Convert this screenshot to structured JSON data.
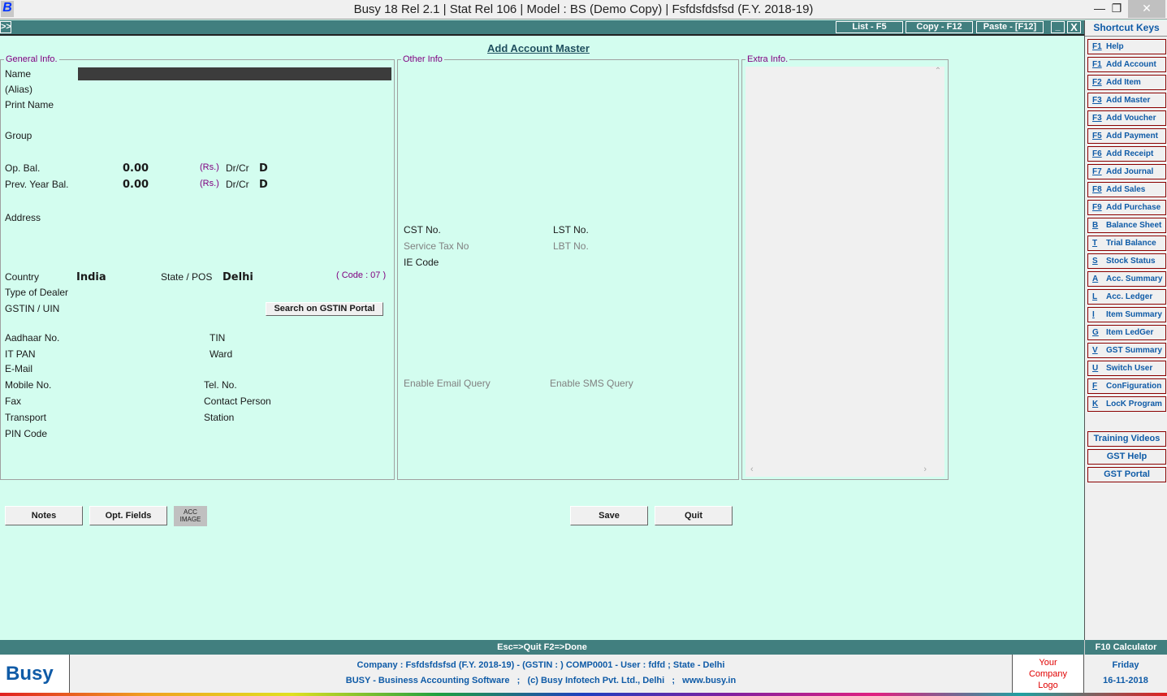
{
  "window": {
    "title": "Busy 18  Rel 2.1  |  Stat Rel 106  |  Model : BS (Demo Copy)  |  Fsfdsfdsfsd (F.Y. 2018-19)",
    "logo": "B",
    "minimize": "—",
    "restore": "❐",
    "close": "✕"
  },
  "toolbar": {
    "expand": ">>",
    "list": "List - F5",
    "copy": "Copy - F12",
    "paste": "Paste - [F12]",
    "min": "_",
    "close": "X"
  },
  "form": {
    "title": "Add Account Master",
    "general": {
      "legend": "General Info.",
      "name": "Name",
      "alias": "(Alias)",
      "print_name": "Print Name",
      "group": "Group",
      "op_bal": "Op. Bal.",
      "op_bal_value": "0.00",
      "prev_bal": "Prev. Year Bal.",
      "prev_bal_value": "0.00",
      "rs": "(Rs.)",
      "drcr": "Dr/Cr",
      "op_drcr_value": "D",
      "prev_drcr_value": "D",
      "address": "Address",
      "country": "Country",
      "country_value": "India",
      "state": "State / POS",
      "state_value": "Delhi",
      "code": "( Code : 07 )",
      "dealer": "Type of Dealer",
      "gstin": "GSTIN / UIN",
      "search_gstin": "Search on GSTIN Portal",
      "aadhaar": "Aadhaar No.",
      "tin": "TIN",
      "itpan": "IT PAN",
      "ward": "Ward",
      "email": "E-Mail",
      "mobile": "Mobile No.",
      "tel": "Tel. No.",
      "fax": "Fax",
      "contact": "Contact Person",
      "transport": "Transport",
      "station": "Station",
      "pin": "PIN Code"
    },
    "other": {
      "legend": "Other Info",
      "cst": "CST No.",
      "lst": "LST No.",
      "service_tax": "Service Tax No",
      "lbt": "LBT No.",
      "ie": "IE Code",
      "email_query": "Enable Email Query",
      "sms_query": "Enable SMS Query"
    },
    "extra": {
      "legend": "Extra Info."
    },
    "buttons": {
      "notes": "Notes",
      "opt_fields": "Opt. Fields",
      "acc_image": "ACC IMAGE",
      "save": "Save",
      "quit": "Quit"
    }
  },
  "shortcuts": {
    "title": "Shortcut Keys",
    "items": [
      {
        "key": "F1",
        "label": "Help"
      },
      {
        "key": "F1",
        "label": "Add Account"
      },
      {
        "key": "F2",
        "label": "Add Item"
      },
      {
        "key": "F3",
        "label": "Add Master"
      },
      {
        "key": "F3",
        "label": "Add Voucher"
      },
      {
        "key": "F5",
        "label": "Add Payment"
      },
      {
        "key": "F6",
        "label": "Add Receipt"
      },
      {
        "key": "F7",
        "label": "Add Journal"
      },
      {
        "key": "F8",
        "label": "Add Sales"
      },
      {
        "key": "F9",
        "label": "Add Purchase"
      },
      {
        "key": "B",
        "label": "Balance Sheet"
      },
      {
        "key": "T",
        "label": "Trial Balance"
      },
      {
        "key": "S",
        "label": "Stock Status"
      },
      {
        "key": "A",
        "label": "Acc. Summary"
      },
      {
        "key": "L",
        "label": "Acc. Ledger"
      },
      {
        "key": "I",
        "label": "Item Summary"
      },
      {
        "key": "G",
        "label": "Item LedGer"
      },
      {
        "key": "V",
        "label": "GST Summary"
      },
      {
        "key": "U",
        "label": "Switch User"
      },
      {
        "key": "F",
        "label": "ConFiguration"
      },
      {
        "key": "K",
        "label": "LocK Program"
      }
    ],
    "extra": [
      "Training Videos",
      "GST Help",
      "GST Portal"
    ]
  },
  "status": {
    "hint": "Esc=>Quit   F2=>Done",
    "calculator": "F10 Calculator"
  },
  "footer": {
    "brand": "Busy",
    "line1": "Company : Fsfdsfdsfsd (F.Y. 2018-19) - (GSTIN : ) COMP0001 - User : fdfd ; State - Delhi",
    "line2": "BUSY - Business Accounting Software   ;   (c) Busy Infotech Pvt. Ltd., Delhi   ;   www.busy.in",
    "logo_placeholder": "Your Company Logo",
    "day": "Friday",
    "date": "16-11-2018"
  },
  "colors": {
    "background": "#d3fdef",
    "teal": "#417f7f",
    "section": "#800080",
    "shortcut_text": "#0f5ba7",
    "shortcut_border": "#8b0000"
  }
}
